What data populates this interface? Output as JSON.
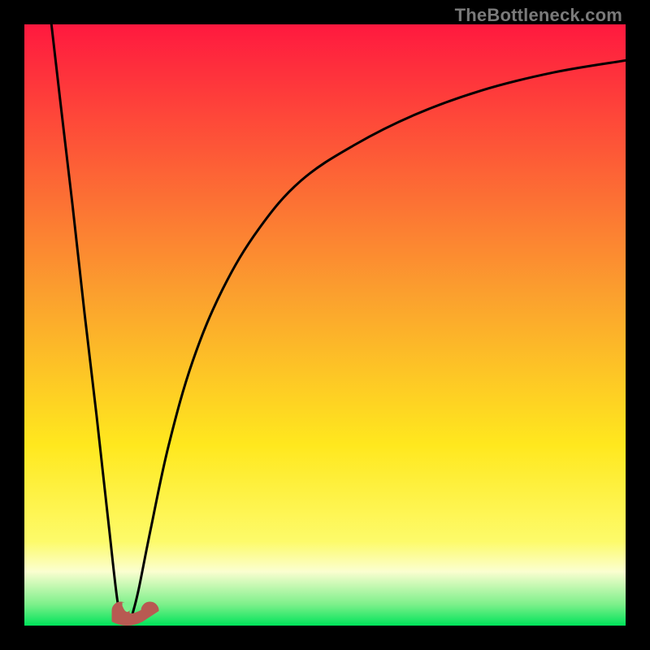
{
  "watermark": "TheBottleneck.com",
  "chart_data": {
    "type": "line",
    "title": "",
    "xlabel": "",
    "ylabel": "",
    "xlim": [
      0,
      100
    ],
    "ylim": [
      0,
      100
    ],
    "grid": false,
    "background_gradient": {
      "stops": [
        {
          "pos": 0.0,
          "color": "#ff193f"
        },
        {
          "pos": 0.45,
          "color": "#fba02e"
        },
        {
          "pos": 0.7,
          "color": "#ffe81e"
        },
        {
          "pos": 0.86,
          "color": "#fdfb6a"
        },
        {
          "pos": 0.91,
          "color": "#fbfed0"
        },
        {
          "pos": 0.965,
          "color": "#7cf08a"
        },
        {
          "pos": 1.0,
          "color": "#00e35a"
        }
      ]
    },
    "series": [
      {
        "name": "left-branch",
        "x": [
          4.5,
          6.0,
          8.0,
          10.0,
          12.0,
          14.0,
          15.5,
          16.3
        ],
        "y": [
          100,
          87,
          70,
          52,
          35,
          17,
          4,
          2
        ]
      },
      {
        "name": "right-branch",
        "x": [
          18.0,
          19.0,
          21.0,
          24.0,
          28.0,
          33.0,
          39.0,
          46.0,
          55.0,
          65.0,
          76.0,
          88.0,
          100.0
        ],
        "y": [
          2,
          6,
          16,
          30,
          44,
          56,
          66,
          74,
          80,
          85,
          89,
          92,
          94
        ]
      }
    ],
    "markers": [
      {
        "name": "notch",
        "cx": 17.1,
        "cy": 2.5,
        "shape": "u-notch",
        "color": "#b85a52"
      }
    ]
  }
}
